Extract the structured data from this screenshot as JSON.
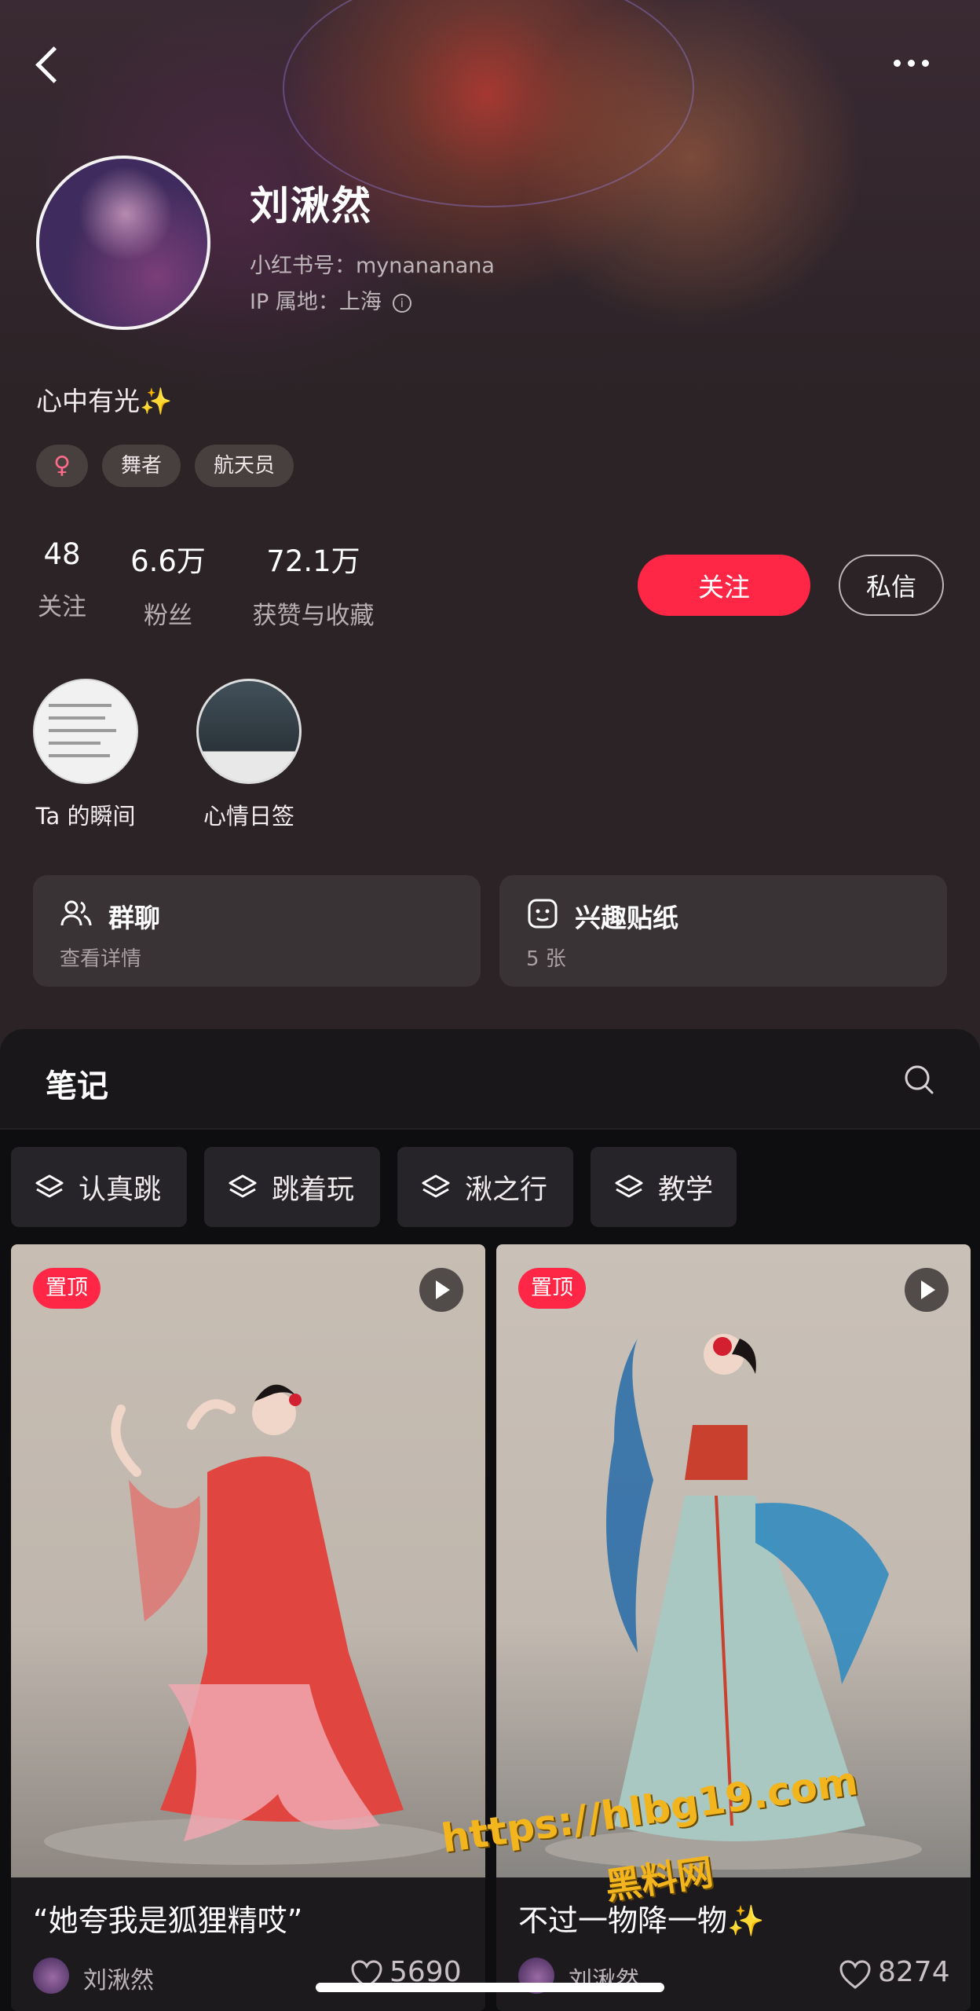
{
  "profile": {
    "name": "刘湫然",
    "xhs_id": "小红书号：mynananana",
    "ip": "IP 属地：上海",
    "bio": "心中有光✨",
    "tags": [
      "♀",
      "舞者",
      "航天员"
    ]
  },
  "stats": [
    {
      "num": "48",
      "label": "关注"
    },
    {
      "num": "6.6万",
      "label": "粉丝"
    },
    {
      "num": "72.1万",
      "label": "获赞与收藏"
    }
  ],
  "actions": {
    "follow": "关注",
    "message": "私信"
  },
  "highlights": [
    {
      "label": "Ta 的瞬间"
    },
    {
      "label": "心情日签"
    }
  ],
  "cards": [
    {
      "title": "群聊",
      "sub": "查看详情",
      "icon": "group-icon"
    },
    {
      "title": "兴趣贴纸",
      "sub": "5 张",
      "icon": "sticker-icon"
    }
  ],
  "notes_section": {
    "title": "笔记"
  },
  "collections": [
    "认真跳",
    "跳着玩",
    "湫之行",
    "教学"
  ],
  "notes": [
    {
      "pin": "置顶",
      "title": "“她夸我是狐狸精哎”",
      "author": "刘湫然",
      "likes": "5690"
    },
    {
      "pin": "置顶",
      "title": "不过一物降一物✨",
      "author": "刘湫然",
      "likes": "8274"
    }
  ],
  "watermark": {
    "line1": "https://hlbg19.com",
    "line2": "黑料网"
  },
  "colors": {
    "accent": "#ff2745",
    "background": "#2b2326"
  }
}
